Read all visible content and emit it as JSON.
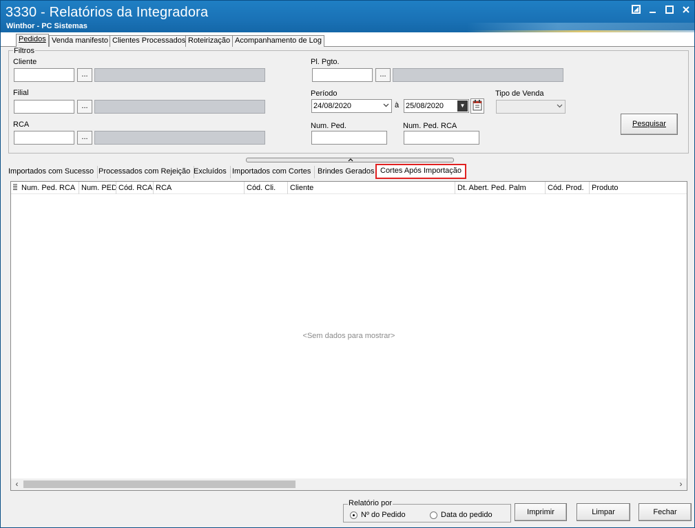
{
  "window": {
    "title": "3330 - Relatórios da Integradora",
    "subtitle": "Winthor - PC Sistemas",
    "controls": [
      "restore-icon",
      "minimize-icon",
      "maximize-icon",
      "close-icon"
    ]
  },
  "main_tabs": [
    {
      "label": "Pedidos",
      "active": true
    },
    {
      "label": "Venda manifesto",
      "active": false
    },
    {
      "label": "Clientes Processados",
      "active": false
    },
    {
      "label": "Roteirização",
      "active": false
    },
    {
      "label": "Acompanhamento de Log",
      "active": false
    }
  ],
  "filters": {
    "legend": "Filtros",
    "cliente": {
      "label": "Cliente",
      "value": "",
      "button": "...",
      "description": ""
    },
    "filial": {
      "label": "Filial",
      "value": "",
      "button": "...",
      "description": ""
    },
    "rca": {
      "label": "RCA",
      "value": "",
      "button": "...",
      "description": ""
    },
    "pl_pgto": {
      "label": "Pl. Pgto.",
      "value": "",
      "button": "...",
      "description": ""
    },
    "periodo": {
      "label": "Período",
      "start": "24/08/2020",
      "separator": "à",
      "end": "25/08/2020"
    },
    "tipo_venda": {
      "label": "Tipo de Venda",
      "value": ""
    },
    "num_ped": {
      "label": "Num. Ped.",
      "value": ""
    },
    "num_ped_rca": {
      "label": "Num. Ped. RCA",
      "value": ""
    },
    "search_button": "Pesquisar"
  },
  "sub_tabs": [
    {
      "label": "Importados com Sucesso",
      "active": false
    },
    {
      "label": "Processados com Rejeição",
      "active": false
    },
    {
      "label": "Excluídos",
      "active": false
    },
    {
      "label": "Importados com Cortes",
      "active": false
    },
    {
      "label": "Brindes Gerados",
      "active": false
    },
    {
      "label": "Cortes Após Importação",
      "active": true
    }
  ],
  "grid": {
    "columns": [
      "Num. Ped. RCA",
      "Num. PED",
      "Cód. RCA",
      "RCA",
      "Cód. Cli.",
      "Cliente",
      "Dt. Abert. Ped. Palm",
      "Cód. Prod.",
      "Produto"
    ],
    "empty_message": "<Sem dados para mostrar>"
  },
  "relatorio": {
    "legend": "Relatório por",
    "options": [
      {
        "label": "Nº do Pedido",
        "selected": true
      },
      {
        "label": "Data do pedido",
        "selected": false
      }
    ]
  },
  "actions": {
    "imprimir": "Imprimir",
    "limpar": "Limpar",
    "fechar": "Fechar"
  }
}
